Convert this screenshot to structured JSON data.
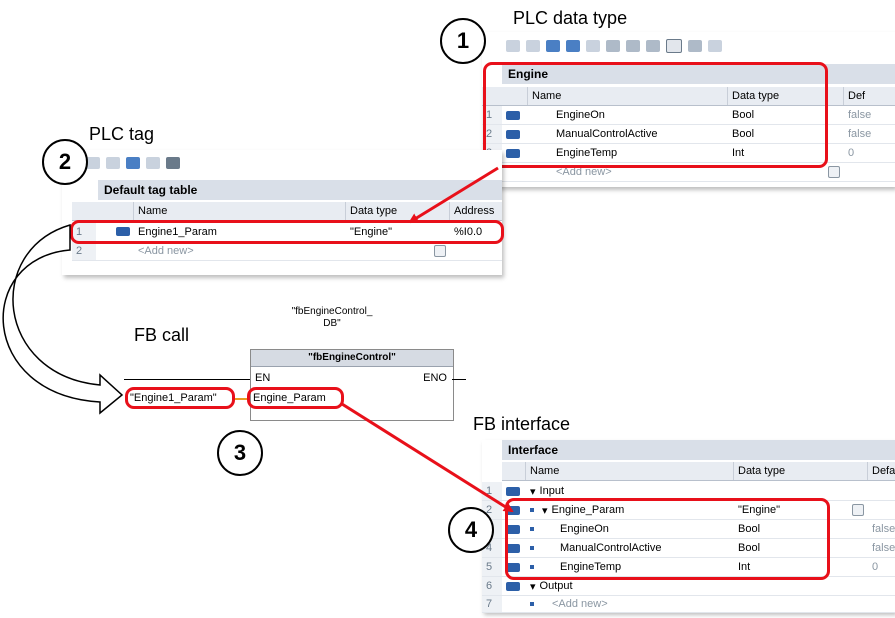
{
  "labels": {
    "plc_data_type": "PLC data type",
    "plc_tag": "PLC tag",
    "fb_call": "FB call",
    "fb_interface": "FB interface"
  },
  "steps": [
    "1",
    "2",
    "3",
    "4"
  ],
  "plc_data_type_panel": {
    "title": "Engine",
    "headers": [
      "Name",
      "Data type",
      "Default"
    ],
    "header_visible": [
      "Name",
      "Data type",
      "Def"
    ],
    "rows": [
      {
        "num": "1",
        "name": "EngineOn",
        "type": "Bool",
        "default": "false"
      },
      {
        "num": "2",
        "name": "ManualControlActive",
        "type": "Bool",
        "default": "false"
      },
      {
        "num": "3",
        "name": "EngineTemp",
        "type": "Int",
        "default": "0"
      },
      {
        "num": "4",
        "name": "<Add new>",
        "type": "",
        "default": ""
      }
    ]
  },
  "plc_tag_panel": {
    "title": "Default tag table",
    "headers": [
      "Name",
      "Data type",
      "Address"
    ],
    "rows": [
      {
        "num": "1",
        "name": "Engine1_Param",
        "type": "\"Engine\"",
        "address": "%I0.0"
      },
      {
        "num": "2",
        "name": "<Add new>",
        "type": "",
        "address": ""
      }
    ]
  },
  "fb_call": {
    "instance_db_line1": "\"fbEngineControl_",
    "instance_db_line2": "DB\"",
    "block_name": "\"fbEngineControl\"",
    "en": "EN",
    "eno": "ENO",
    "input_pin": "Engine_Param",
    "actual_param": "\"Engine1_Param\""
  },
  "fb_interface_panel": {
    "title": "Interface",
    "headers": [
      "Name",
      "Data type",
      "Default"
    ],
    "rows": [
      {
        "num": "1",
        "name": "Input",
        "type": "",
        "default": "",
        "level": 0
      },
      {
        "num": "2",
        "name": "Engine_Param",
        "type": "\"Engine\"",
        "default": "",
        "level": 1
      },
      {
        "num": "3",
        "name": "EngineOn",
        "type": "Bool",
        "default": "false",
        "level": 2
      },
      {
        "num": "4",
        "name": "ManualControlActive",
        "type": "Bool",
        "default": "false",
        "level": 2
      },
      {
        "num": "5",
        "name": "EngineTemp",
        "type": "Int",
        "default": "0",
        "level": 2
      },
      {
        "num": "6",
        "name": "Output",
        "type": "",
        "default": "",
        "level": 0
      },
      {
        "num": "7",
        "name": "<Add new>",
        "type": "",
        "default": "",
        "level": 1
      }
    ]
  },
  "colors": {
    "highlight": "#e8101a",
    "tag_icon": "#2c5fa8"
  }
}
